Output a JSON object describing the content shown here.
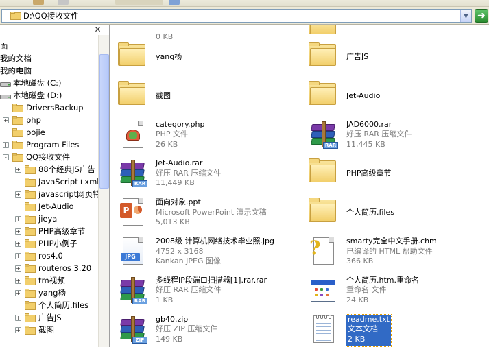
{
  "address": {
    "path": "D:\\QQ接收文件"
  },
  "tree": {
    "items": [
      {
        "label": "面",
        "indent": 0,
        "expander": "",
        "icon": "none"
      },
      {
        "label": "我的文档",
        "indent": 0,
        "expander": "",
        "icon": "none"
      },
      {
        "label": "我的电脑",
        "indent": 0,
        "expander": "",
        "icon": "none"
      },
      {
        "label": "本地磁盘 (C:)",
        "indent": 1,
        "expander": "",
        "icon": "drive"
      },
      {
        "label": "本地磁盘 (D:)",
        "indent": 1,
        "expander": "",
        "icon": "drive"
      },
      {
        "label": "DriversBackup",
        "indent": 2,
        "expander": "",
        "icon": "folder"
      },
      {
        "label": "php",
        "indent": 2,
        "expander": "+",
        "icon": "folder"
      },
      {
        "label": "pojie",
        "indent": 2,
        "expander": "",
        "icon": "folder"
      },
      {
        "label": "Program Files",
        "indent": 2,
        "expander": "+",
        "icon": "folder"
      },
      {
        "label": "QQ接收文件",
        "indent": 2,
        "expander": "-",
        "icon": "folder-open"
      },
      {
        "label": "88个经典JS广告",
        "indent": 3,
        "expander": "+",
        "icon": "folder"
      },
      {
        "label": "JavaScript+xml",
        "indent": 3,
        "expander": "",
        "icon": "folder"
      },
      {
        "label": "javascript网页特",
        "indent": 3,
        "expander": "+",
        "icon": "folder"
      },
      {
        "label": "Jet-Audio",
        "indent": 3,
        "expander": "",
        "icon": "folder"
      },
      {
        "label": "jieya",
        "indent": 3,
        "expander": "+",
        "icon": "folder"
      },
      {
        "label": "PHP高级章节",
        "indent": 3,
        "expander": "+",
        "icon": "folder"
      },
      {
        "label": "PHP小例子",
        "indent": 3,
        "expander": "+",
        "icon": "folder"
      },
      {
        "label": "ros4.0",
        "indent": 3,
        "expander": "+",
        "icon": "folder"
      },
      {
        "label": "routeros 3.20",
        "indent": 3,
        "expander": "+",
        "icon": "folder"
      },
      {
        "label": "tm视频",
        "indent": 3,
        "expander": "+",
        "icon": "folder"
      },
      {
        "label": "yang杨",
        "indent": 3,
        "expander": "+",
        "icon": "folder"
      },
      {
        "label": "个人简历.files",
        "indent": 3,
        "expander": "",
        "icon": "folder"
      },
      {
        "label": "广告JS",
        "indent": 3,
        "expander": "+",
        "icon": "folder"
      },
      {
        "label": "截图",
        "indent": 3,
        "expander": "+",
        "icon": "folder"
      }
    ]
  },
  "files": [
    {
      "name": "",
      "line2": "0 KB",
      "line3": "",
      "icon": "doc",
      "col": 0,
      "row": -1
    },
    {
      "name": "",
      "line2": "",
      "line3": "",
      "icon": "folder",
      "col": 1,
      "row": -1
    },
    {
      "name": "yang杨",
      "line2": "",
      "line3": "",
      "icon": "folder",
      "col": 0,
      "row": 0
    },
    {
      "name": "广告JS",
      "line2": "",
      "line3": "",
      "icon": "folder",
      "col": 1,
      "row": 0
    },
    {
      "name": "截图",
      "line2": "",
      "line3": "",
      "icon": "folder",
      "col": 0,
      "row": 1
    },
    {
      "name": "Jet-Audio",
      "line2": "",
      "line3": "",
      "icon": "folder",
      "col": 1,
      "row": 1
    },
    {
      "name": "category.php",
      "line2": "PHP 文件",
      "line3": "26 KB",
      "icon": "php",
      "col": 0,
      "row": 2
    },
    {
      "name": "JAD6000.rar",
      "line2": "好压 RAR 压缩文件",
      "line3": "11,445 KB",
      "icon": "rar",
      "col": 1,
      "row": 2
    },
    {
      "name": "Jet-Audio.rar",
      "line2": "好压 RAR 压缩文件",
      "line3": "11,449 KB",
      "icon": "rar",
      "col": 0,
      "row": 3
    },
    {
      "name": "PHP高级章节",
      "line2": "",
      "line3": "",
      "icon": "folder",
      "col": 1,
      "row": 3
    },
    {
      "name": "面向对象.ppt",
      "line2": "Microsoft PowerPoint 演示文稿",
      "line3": "5,013 KB",
      "icon": "ppt",
      "col": 0,
      "row": 4
    },
    {
      "name": "个人简历.files",
      "line2": "",
      "line3": "",
      "icon": "folder",
      "col": 1,
      "row": 4
    },
    {
      "name": "2008级 计算机网络技术毕业照.jpg",
      "line2": "4752 x 3168",
      "line3": "Kankan JPEG 图像",
      "icon": "jpg",
      "col": 0,
      "row": 5
    },
    {
      "name": "smarty完全中文手册.chm",
      "line2": "已编译的 HTML 帮助文件",
      "line3": "366 KB",
      "icon": "chm",
      "col": 1,
      "row": 5
    },
    {
      "name": "多线程IP段端口扫描器[1].rar.rar",
      "line2": "好压 RAR 压缩文件",
      "line3": "1 KB",
      "icon": "rar",
      "col": 0,
      "row": 6
    },
    {
      "name": "个人简历.htm.重命名",
      "line2": "重命名 文件",
      "line3": "24 KB",
      "icon": "win",
      "col": 1,
      "row": 6
    },
    {
      "name": "gb40.zip",
      "line2": "好压 ZIP 压缩文件",
      "line3": "149 KB",
      "icon": "zip",
      "col": 0,
      "row": 7
    },
    {
      "name": "readme.txt",
      "line2": "文本文档",
      "line3": "2 KB",
      "icon": "txt",
      "col": 1,
      "row": 7,
      "selected": true
    }
  ],
  "colors": {
    "selection": "#316ac5",
    "meta_text": "#7b7b7b",
    "folder": "#f2cf6b"
  }
}
